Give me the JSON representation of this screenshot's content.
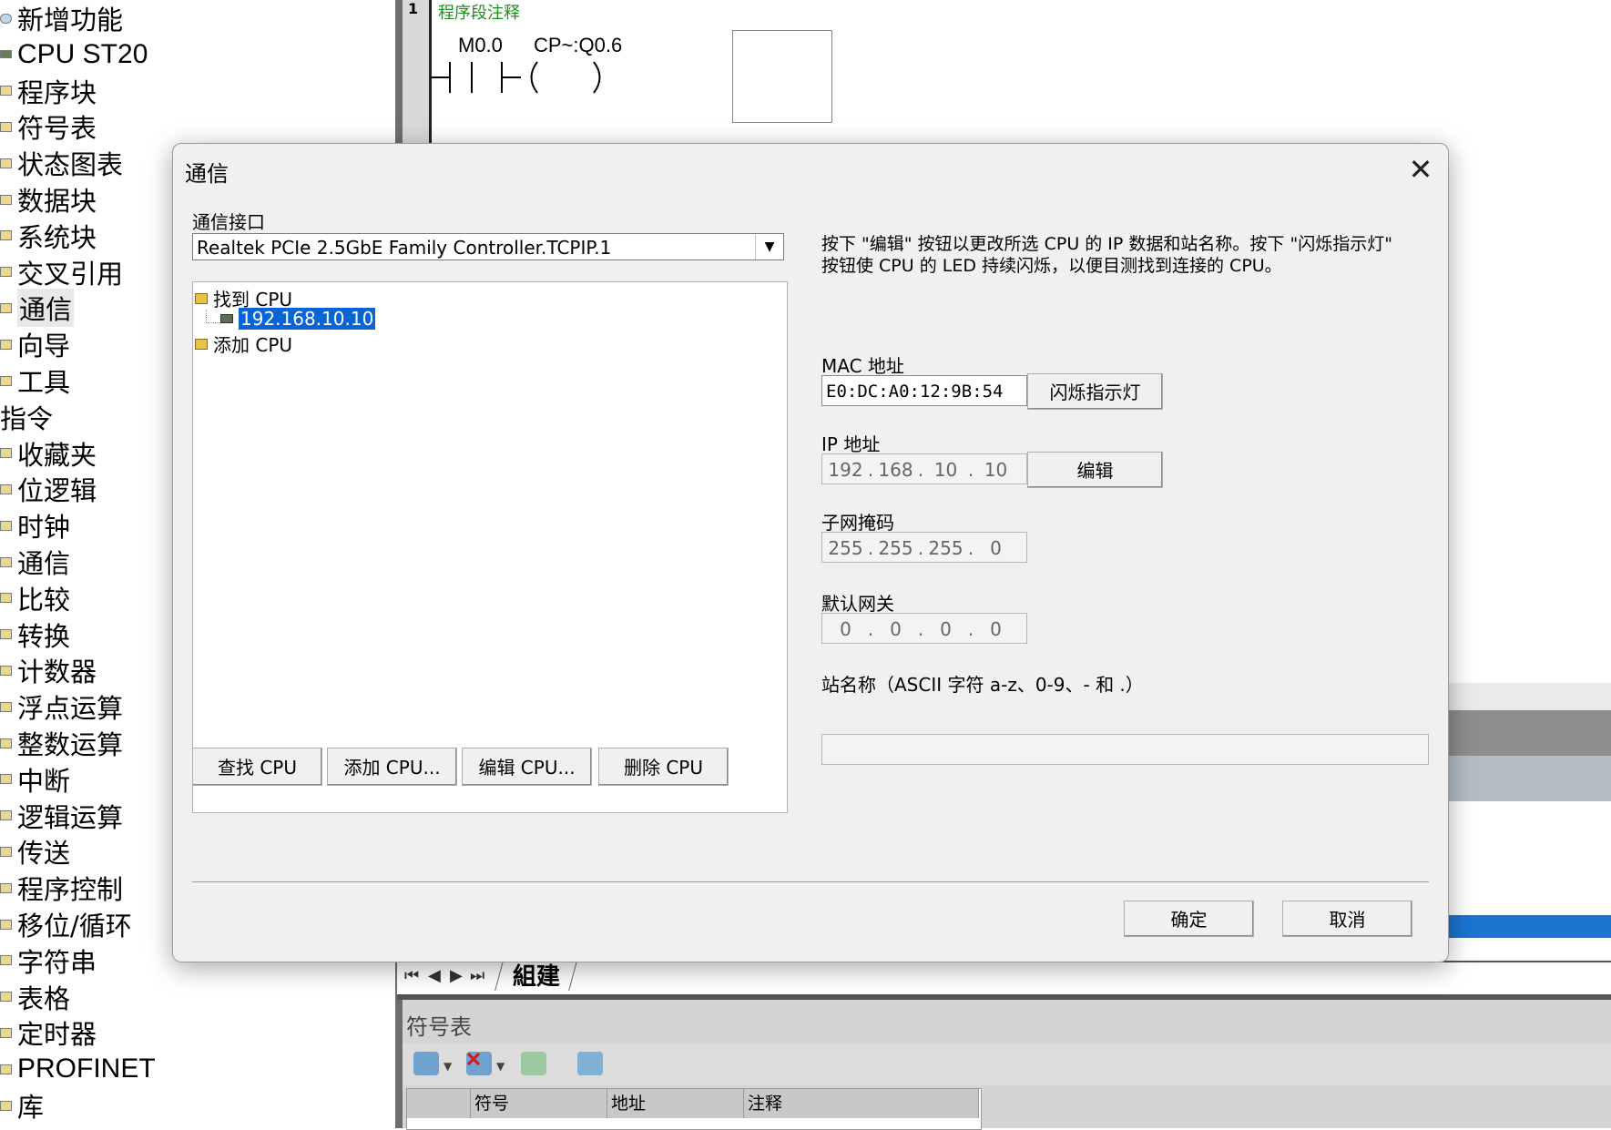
{
  "project_tree": {
    "items": [
      {
        "label": "新增功能",
        "kind": "new"
      },
      {
        "label": "CPU ST20",
        "kind": "cpu"
      },
      {
        "label": "程序块",
        "kind": "folder"
      },
      {
        "label": "符号表",
        "kind": "folder"
      },
      {
        "label": "状态图表",
        "kind": "folder"
      },
      {
        "label": "数据块",
        "kind": "folder"
      },
      {
        "label": "系统块",
        "kind": "folder"
      },
      {
        "label": "交叉引用",
        "kind": "folder"
      },
      {
        "label": "通信",
        "kind": "folder",
        "selected": true
      },
      {
        "label": "向导",
        "kind": "folder"
      },
      {
        "label": "工具",
        "kind": "folder"
      },
      {
        "label": "指令",
        "kind": "group"
      },
      {
        "label": "收藏夹",
        "kind": "folder"
      },
      {
        "label": "位逻辑",
        "kind": "folder"
      },
      {
        "label": "时钟",
        "kind": "folder"
      },
      {
        "label": "通信",
        "kind": "folder"
      },
      {
        "label": "比较",
        "kind": "folder"
      },
      {
        "label": "转换",
        "kind": "folder"
      },
      {
        "label": "计数器",
        "kind": "folder"
      },
      {
        "label": "浮点运算",
        "kind": "folder"
      },
      {
        "label": "整数运算",
        "kind": "folder"
      },
      {
        "label": "中断",
        "kind": "folder"
      },
      {
        "label": "逻辑运算",
        "kind": "folder"
      },
      {
        "label": "传送",
        "kind": "folder"
      },
      {
        "label": "程序控制",
        "kind": "folder"
      },
      {
        "label": "移位/循环",
        "kind": "folder"
      },
      {
        "label": "字符串",
        "kind": "folder"
      },
      {
        "label": "表格",
        "kind": "folder"
      },
      {
        "label": "定时器",
        "kind": "folder"
      },
      {
        "label": "PROFINET",
        "kind": "folder"
      },
      {
        "label": "库",
        "kind": "folder"
      }
    ]
  },
  "ladder": {
    "rung_number": "1",
    "comment": "程序段注释",
    "contact": "M0.0",
    "coil": "CP~:Q0.6"
  },
  "sheet_tabs": {
    "active": "組建"
  },
  "symbol_table": {
    "title": "符号表",
    "columns": [
      "符号",
      "地址",
      "注释"
    ]
  },
  "dialog": {
    "title": "通信",
    "interface_label": "通信接口",
    "interface_value": "Realtek PCIe 2.5GbE Family Controller.TCPIP.1",
    "tree": {
      "found_cpu": "找到 CPU",
      "found_ip": "192.168.10.10",
      "add_cpu": "添加 CPU"
    },
    "buttons": {
      "find_cpu": "查找 CPU",
      "add_cpu": "添加 CPU...",
      "edit_cpu": "编辑 CPU...",
      "delete_cpu": "删除 CPU",
      "blink": "闪烁指示灯",
      "edit": "编辑",
      "ok": "确定",
      "cancel": "取消"
    },
    "description": "按下 \"编辑\" 按钮以更改所选 CPU 的 IP 数据和站名称。按下 \"闪烁指示灯\" 按钮使 CPU 的 LED 持续闪烁，以便目测找到连接的 CPU。",
    "mac_label": "MAC 地址",
    "mac_value": "E0:DC:A0:12:9B:54",
    "ip_label": "IP 地址",
    "ip": [
      "192",
      "168",
      "10",
      "10"
    ],
    "subnet_label": "子网掩码",
    "subnet": [
      "255",
      "255",
      "255",
      "0"
    ],
    "gateway_label": "默认网关",
    "gateway": [
      "0",
      "0",
      "0",
      "0"
    ],
    "station_label": "站名称（ASCII 字符 a-z、0-9、- 和 .）",
    "station_value": ""
  }
}
